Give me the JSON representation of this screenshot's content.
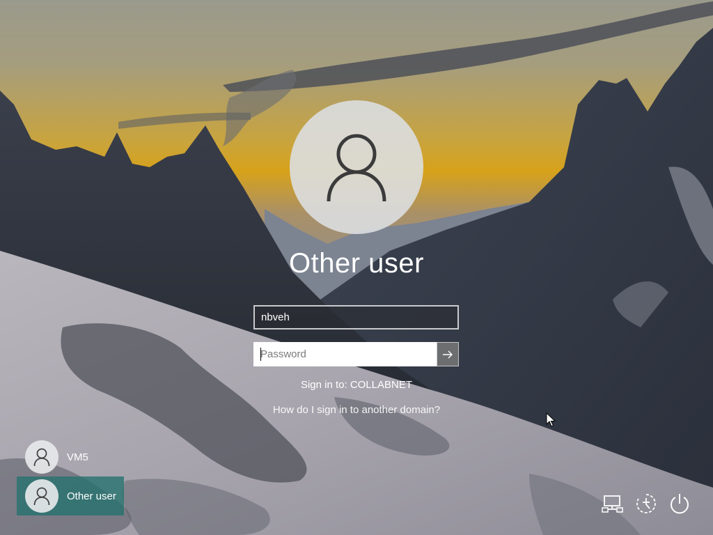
{
  "login": {
    "display_name": "Other user",
    "username_value": "nbveh",
    "password_placeholder": "Password",
    "sign_in_to": "Sign in to: COLLABNET",
    "other_domain_link": "How do I sign in to another domain?"
  },
  "user_list": [
    {
      "name": "VM5",
      "selected": false
    },
    {
      "name": "Other user",
      "selected": true
    }
  ],
  "system_icons": [
    "network-icon",
    "ease-of-access-icon",
    "power-icon"
  ],
  "colors": {
    "selected_tile": "#26726e",
    "sky_gold": "#e0a818"
  }
}
